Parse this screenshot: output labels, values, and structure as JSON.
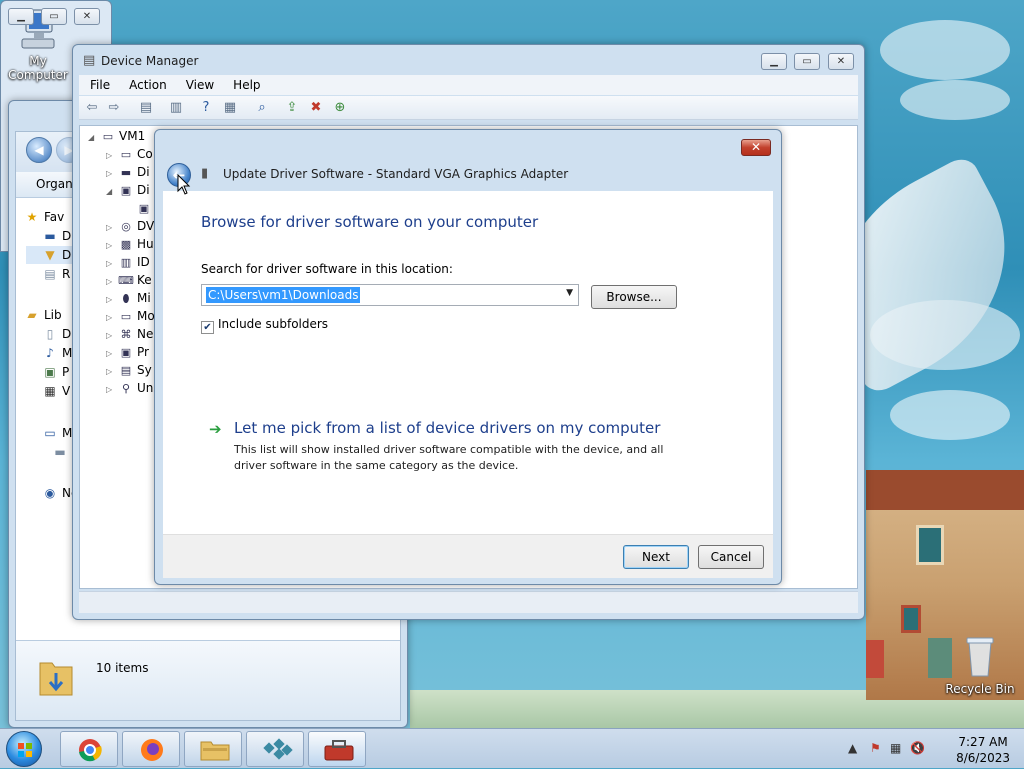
{
  "desktop": {
    "icons": [
      {
        "label": "My Computer"
      },
      {
        "label": "Recycle Bin"
      }
    ]
  },
  "explorer": {
    "organize_label": "Organi",
    "nav_items": [
      {
        "label": "Fav",
        "icon": "star-icon"
      },
      {
        "label": "D",
        "icon": "desktop-icon"
      },
      {
        "label": "D",
        "icon": "downloads-icon"
      },
      {
        "label": "R",
        "icon": "recent-places-icon"
      },
      {
        "label": "Lib",
        "icon": "libraries-icon"
      },
      {
        "label": "D",
        "icon": "documents-icon"
      },
      {
        "label": "M",
        "icon": "music-icon"
      },
      {
        "label": "P",
        "icon": "pictures-icon"
      },
      {
        "label": "V",
        "icon": "videos-icon"
      },
      {
        "label": "My",
        "icon": "computer-icon"
      },
      {
        "label": "L",
        "icon": "local-disk-icon"
      },
      {
        "label": "Ne",
        "icon": "network-icon"
      }
    ],
    "status_count": "10 items"
  },
  "device_manager": {
    "title": "Device Manager",
    "menu": [
      "File",
      "Action",
      "View",
      "Help"
    ],
    "tree_root": "VM1",
    "tree_items": [
      {
        "label": "Co",
        "expander": "▷",
        "icon": "computer-icon"
      },
      {
        "label": "Di",
        "expander": "▷",
        "icon": "disk-drive-icon"
      },
      {
        "label": "Di",
        "expander": "◢",
        "icon": "display-adapter-icon"
      },
      {
        "label": "",
        "expander": "",
        "icon": "display-device-icon"
      },
      {
        "label": "DV",
        "expander": "▷",
        "icon": "dvd-drive-icon"
      },
      {
        "label": "Hu",
        "expander": "▷",
        "icon": "hid-icon"
      },
      {
        "label": "ID",
        "expander": "▷",
        "icon": "ide-controller-icon"
      },
      {
        "label": "Ke",
        "expander": "▷",
        "icon": "keyboard-icon"
      },
      {
        "label": "Mi",
        "expander": "▷",
        "icon": "mouse-icon"
      },
      {
        "label": "Mo",
        "expander": "▷",
        "icon": "monitor-icon"
      },
      {
        "label": "Ne",
        "expander": "▷",
        "icon": "network-adapter-icon"
      },
      {
        "label": "Pr",
        "expander": "▷",
        "icon": "processor-icon"
      },
      {
        "label": "Sy",
        "expander": "▷",
        "icon": "system-devices-icon"
      },
      {
        "label": "Un",
        "expander": "▷",
        "icon": "usb-controller-icon"
      }
    ]
  },
  "dialog": {
    "title": "Update Driver Software - Standard VGA Graphics Adapter",
    "heading": "Browse for driver software on your computer",
    "search_label": "Search for driver software in this location:",
    "path_value": "C:\\Users\\vm1\\Downloads",
    "browse_label": "Browse...",
    "include_subfolders_label": "Include subfolders",
    "include_subfolders_checked": true,
    "pick_link": "Let me pick from a list of device drivers on my computer",
    "pick_desc": "This list will show installed driver software compatible with the device, and all driver software in the same category as the device.",
    "next_label": "Next",
    "cancel_label": "Cancel"
  },
  "taskbar": {
    "time": "7:27 AM",
    "date": "8/6/2023",
    "apps": [
      {
        "name": "chrome-icon"
      },
      {
        "name": "firefox-icon"
      },
      {
        "name": "file-explorer-icon"
      },
      {
        "name": "registry-editor-icon"
      },
      {
        "name": "toolbox-icon"
      }
    ]
  },
  "colors": {
    "heading_blue": "#1e3f8c",
    "selection_blue": "#3399ff",
    "close_red": "#c2412d",
    "link_arrow_green": "#2a9e3f"
  }
}
